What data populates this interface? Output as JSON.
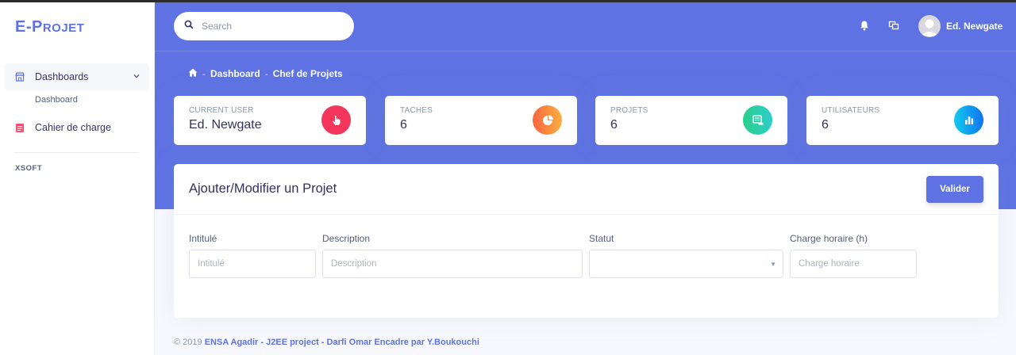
{
  "brand": "E-Projet",
  "sidebar": {
    "items": [
      {
        "label": "Dashboards",
        "icon": "store-icon"
      },
      {
        "label": "Cahier de charge",
        "icon": "document-icon"
      }
    ],
    "sub_items": [
      "Dashboard"
    ],
    "heading": "XSOFT"
  },
  "topnav": {
    "search_placeholder": "Search",
    "user_name": "Ed. Newgate"
  },
  "breadcrumb": {
    "home_icon": "home-icon",
    "items": [
      "Dashboard",
      "Chef de Projets"
    ]
  },
  "stats": [
    {
      "label": "CURRENT USER",
      "value": "Ed. Newgate",
      "icon": "hand-pointer-icon",
      "color": "#f5365c"
    },
    {
      "label": "TACHES",
      "value": "6",
      "icon": "pie-chart-icon",
      "color": "#fb6340"
    },
    {
      "label": "PROJETS",
      "value": "6",
      "icon": "database-icon",
      "color": "#2dce89"
    },
    {
      "label": "UTILISATEURS",
      "value": "6",
      "icon": "bar-chart-icon",
      "color": "#11cdef"
    }
  ],
  "form": {
    "title": "Ajouter/Modifier un Projet",
    "submit_label": "Valider",
    "fields": [
      {
        "label": "Intitulé",
        "placeholder": "Intitulé"
      },
      {
        "label": "Description",
        "placeholder": "Description"
      },
      {
        "label": "Statut",
        "value": ""
      },
      {
        "label": "Charge horaire (h)",
        "placeholder": "Charge horaire"
      }
    ]
  },
  "footer": {
    "copyright": "© 2019",
    "link": "ENSA Agadir - J2EE project - Darfi Omar Encadre par Y.Boukouchi"
  },
  "colors": {
    "primary": "#5e72e4",
    "text_dark": "#32325d",
    "text_muted": "#8898aa"
  }
}
